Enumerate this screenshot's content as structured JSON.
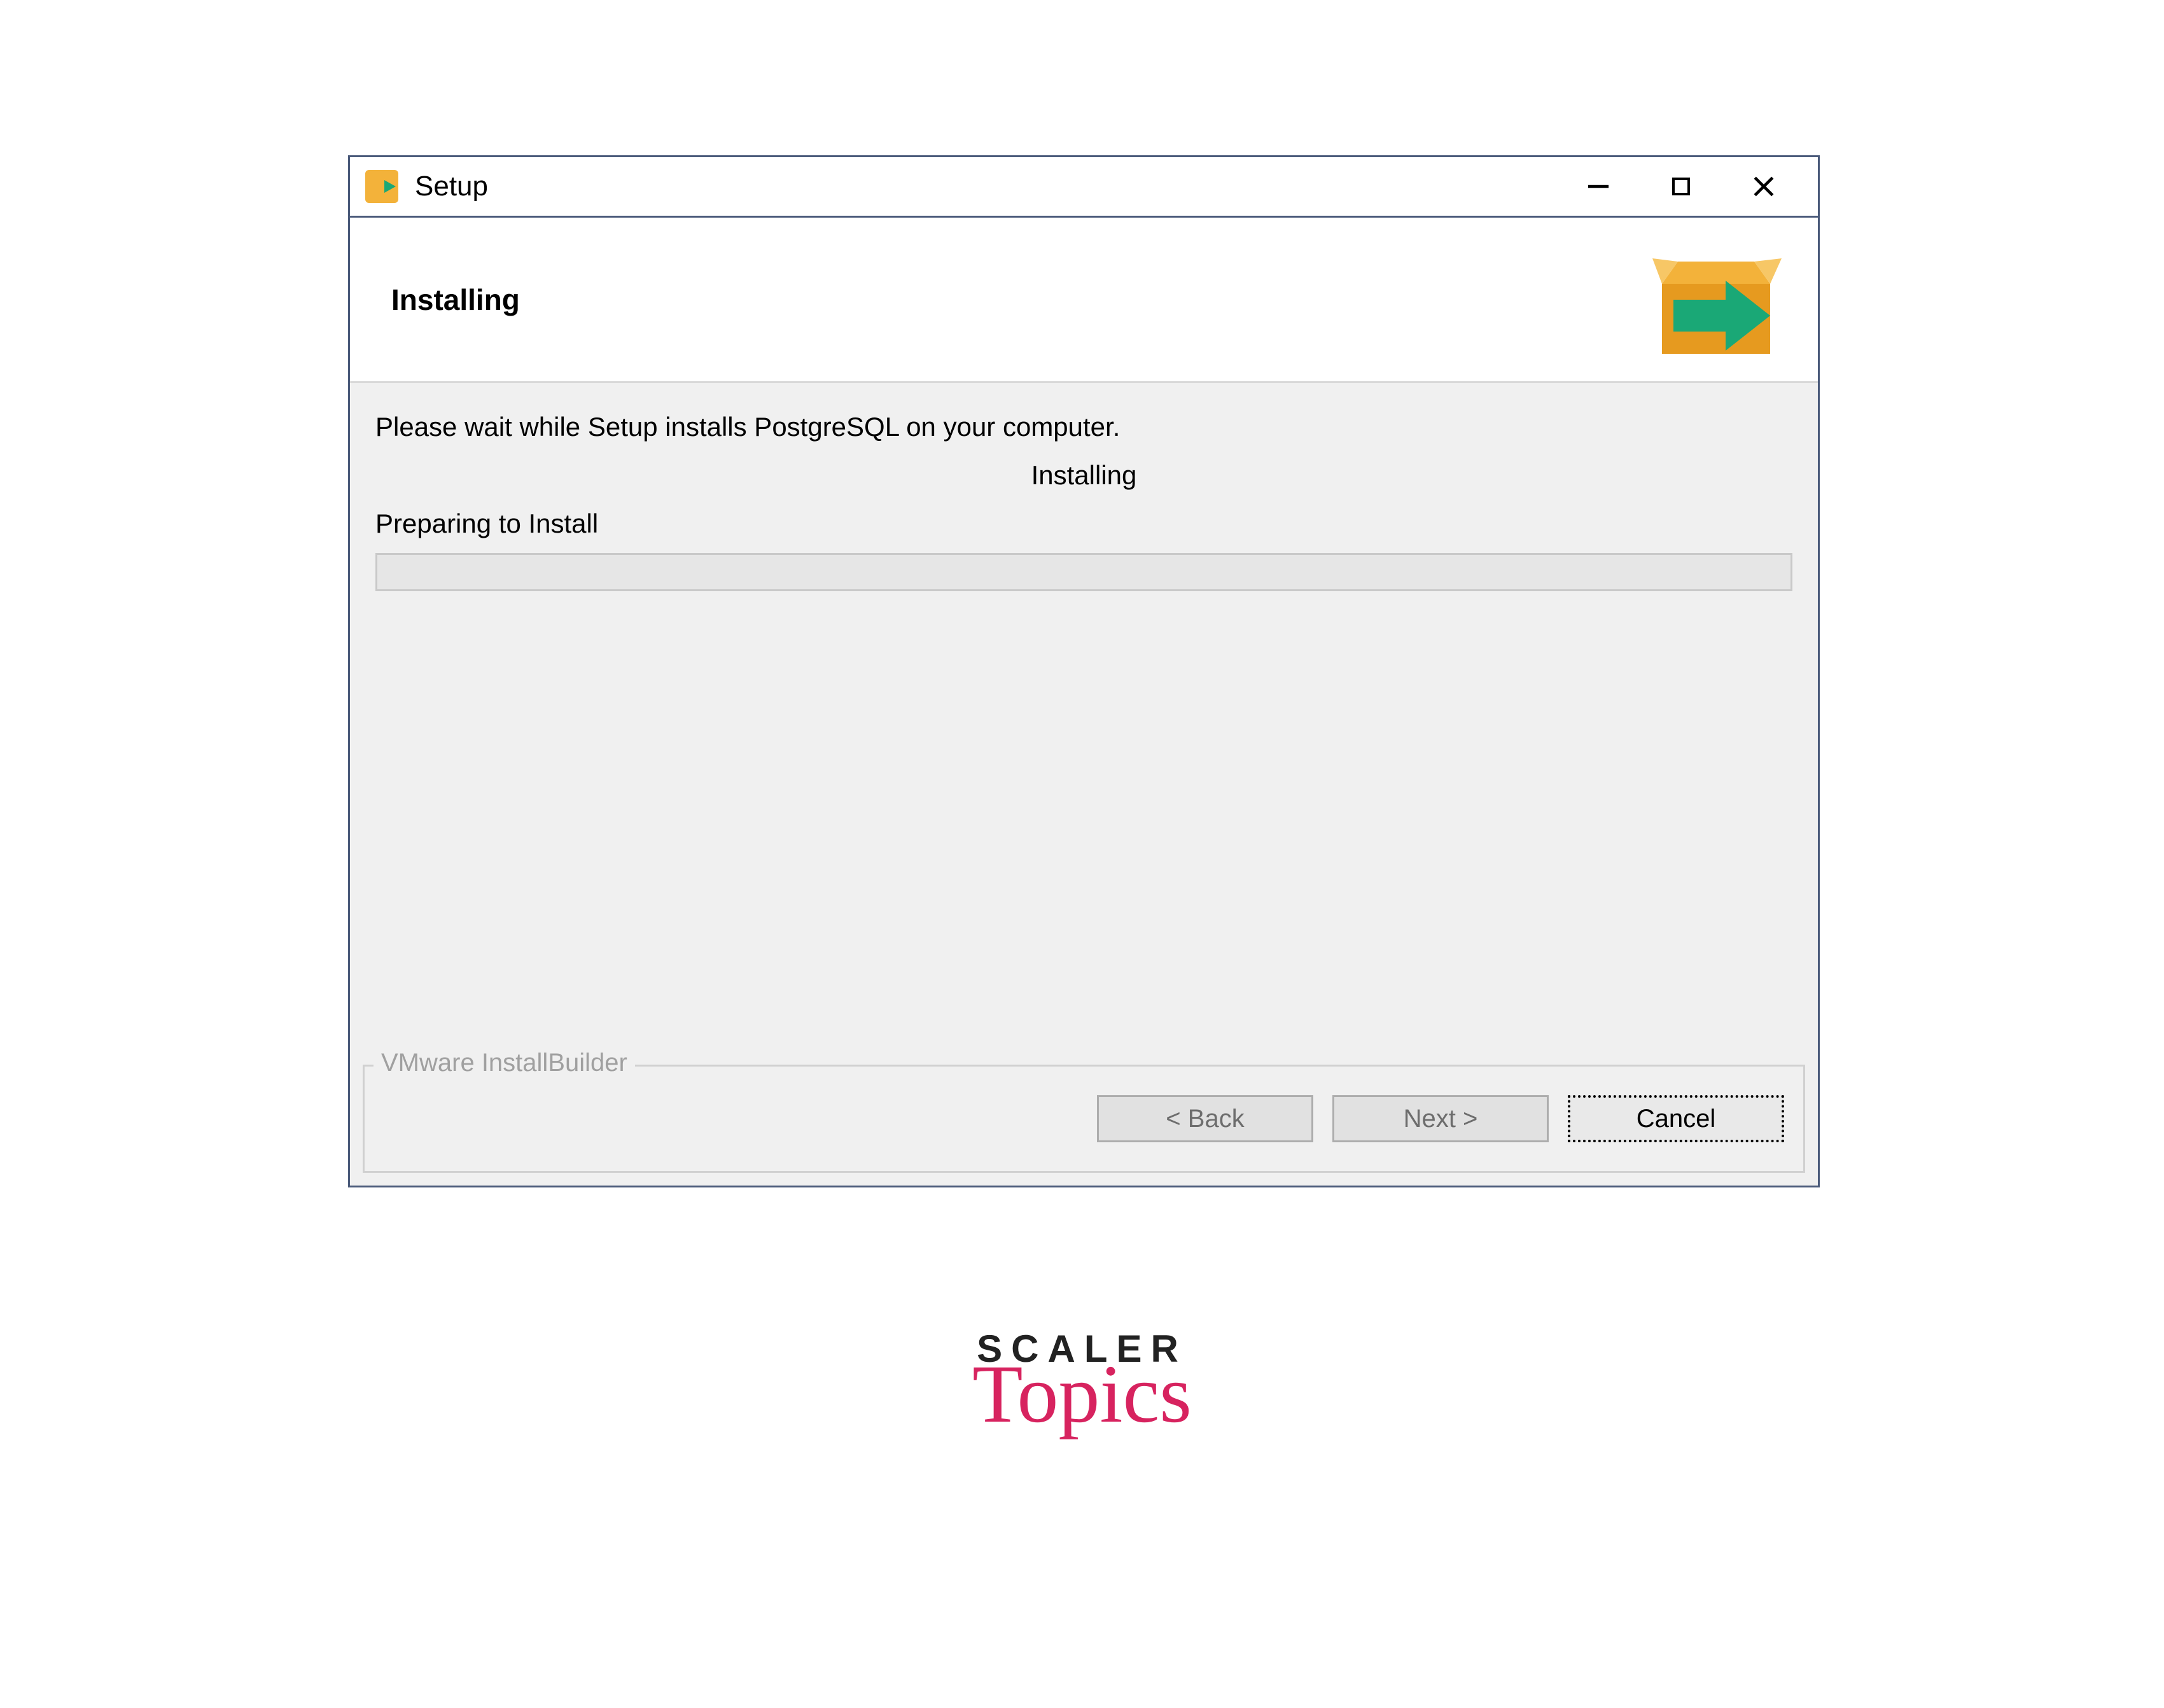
{
  "window": {
    "title": "Setup"
  },
  "header": {
    "heading": "Installing"
  },
  "body": {
    "message": "Please wait while Setup installs PostgreSQL on your computer.",
    "centered_label": "Installing",
    "status": "Preparing to Install"
  },
  "footer": {
    "legend": "VMware InstallBuilder",
    "back_label": "< Back",
    "next_label": "Next >",
    "cancel_label": "Cancel"
  },
  "logo": {
    "line1": "SCALER",
    "line2": "Topics"
  }
}
